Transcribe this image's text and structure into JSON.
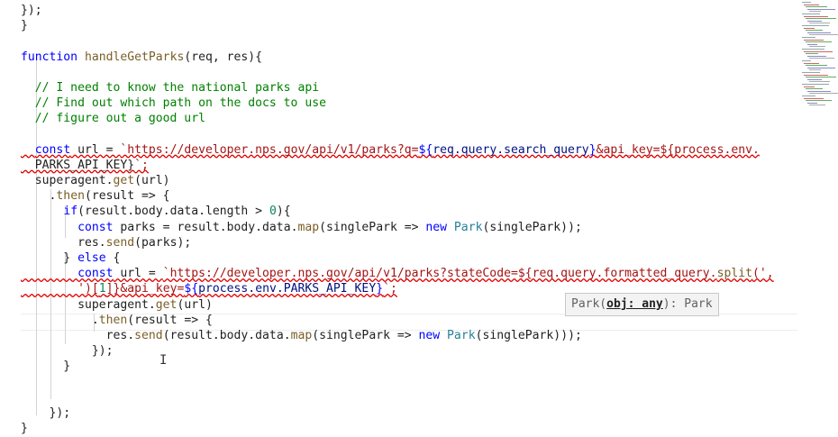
{
  "editor": {
    "language": "javascript",
    "lines": [
      "});",
      "}",
      "",
      "function handleGetParks(req, res){",
      "",
      "  // I need to know the national parks api",
      "  // Find out which path on the docs to use",
      "  // figure out a good url",
      "",
      "  const url = `https://developer.nps.gov/api/v1/parks?q=${req.query.search_query}&api_key=${process.env.",
      "  PARKS_API_KEY}`;",
      "  superagent.get(url)",
      "    .then(result => {",
      "      if(result.body.data.length > 0){",
      "        const parks = result.body.data.map(singlePark => new Park(singlePark));",
      "        res.send(parks);",
      "      } else {",
      "        const url = `https://developer.nps.gov/api/v1/parks?stateCode=${req.query.formatted_query.split(',",
      "        ')[1]}&api_key=${process.env.PARKS_API_KEY}`;",
      "        superagent.get(url)",
      "          .then(result => {",
      "            res.send(result.body.data.map(singlePark => new Park(singlePark)));",
      "          });",
      "      }",
      "",
      "",
      "    });",
      "}"
    ]
  },
  "tooltip": {
    "prefix": "Park(",
    "param": "obj: any",
    "suffix": "): Park"
  },
  "colors": {
    "keyword": "#0000ff",
    "function": "#795e26",
    "variable": "#001080",
    "class": "#267f99",
    "number": "#098658",
    "string": "#a31515",
    "comment": "#008000"
  }
}
